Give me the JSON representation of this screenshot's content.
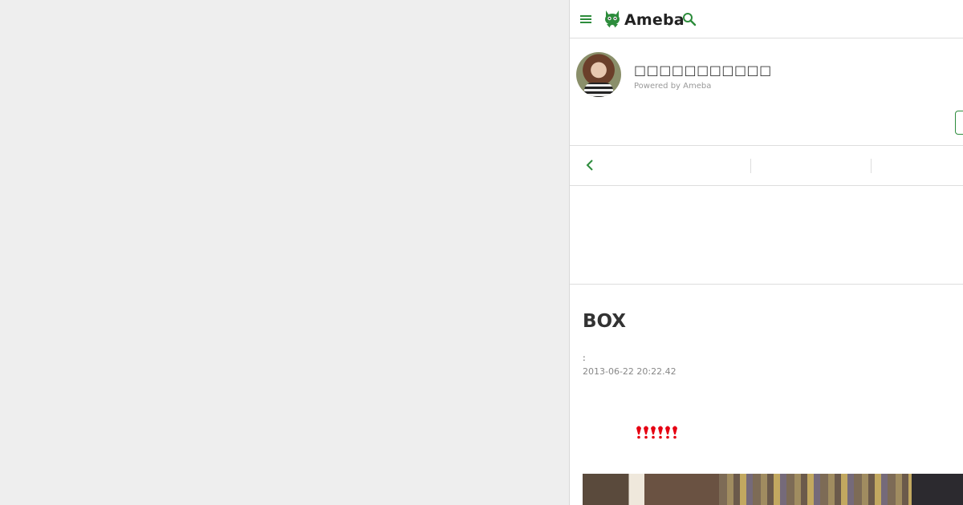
{
  "header": {
    "logo_text": "Ameba",
    "menu_icon": "hamburger-menu-icon",
    "search_icon": "search-icon",
    "brand_color": "#2d8c3c"
  },
  "profile": {
    "blog_title": "□□□□□□□□□□□",
    "powered_by": "Powered by Ameba"
  },
  "nav": {
    "back_icon": "chevron-left-icon"
  },
  "entry": {
    "title": "BOX",
    "theme": ":",
    "date": "2013-06-22 20:22.42",
    "emoji_count": 6,
    "emoji_color": "#e60012"
  }
}
